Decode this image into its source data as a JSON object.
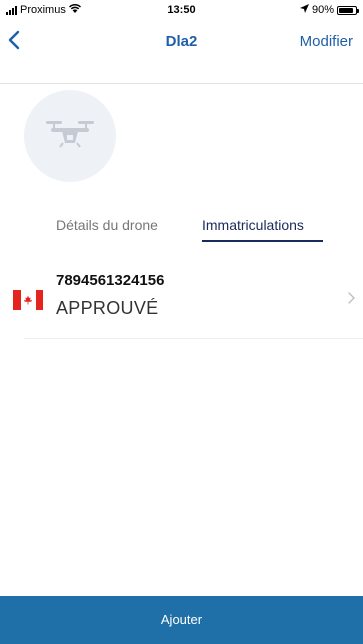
{
  "status_bar": {
    "carrier": "Proximus",
    "time": "13:50",
    "battery": "90%",
    "battery_level": 0.9,
    "icons": [
      "signal-icon",
      "wifi-icon",
      "location-arrow-icon",
      "battery-icon"
    ]
  },
  "nav": {
    "back_icon": "chevron-left-icon",
    "title": "Dla2",
    "edit_label": "Modifier"
  },
  "drone": {
    "avatar_icon": "drone-icon"
  },
  "tabs": [
    {
      "label": "Détails du drone",
      "active": false
    },
    {
      "label": "Immatriculations",
      "active": true
    }
  ],
  "registrations": [
    {
      "country_flag": "canada-flag-icon",
      "number": "7894561324156",
      "status": "APPROUVÉ"
    }
  ],
  "footer": {
    "add_label": "Ajouter"
  },
  "colors": {
    "accent": "#1f5fa8",
    "button": "#1f6fa8",
    "tab_active": "#1a2a5a",
    "tab_inactive": "#777777",
    "avatar_bg": "#eef1f6",
    "flag_red": "#e52420"
  }
}
